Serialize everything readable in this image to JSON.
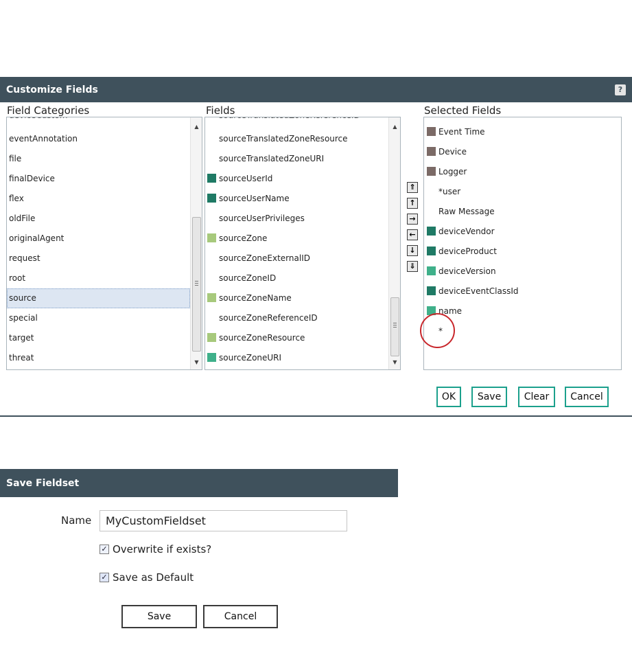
{
  "customize": {
    "title": "Customize Fields",
    "help_icon": "?",
    "categories_header": "Field Categories",
    "fields_header": "Fields",
    "selected_header": "Selected Fields",
    "categories": [
      {
        "label": "eventAnnotation",
        "selected": false
      },
      {
        "label": "file",
        "selected": false
      },
      {
        "label": "finalDevice",
        "selected": false
      },
      {
        "label": "flex",
        "selected": false
      },
      {
        "label": "oldFile",
        "selected": false
      },
      {
        "label": "originalAgent",
        "selected": false
      },
      {
        "label": "request",
        "selected": false
      },
      {
        "label": "root",
        "selected": false
      },
      {
        "label": "source",
        "selected": true
      },
      {
        "label": "special",
        "selected": false
      },
      {
        "label": "target",
        "selected": false
      },
      {
        "label": "threat",
        "selected": false
      }
    ],
    "fields": [
      {
        "label": "sourceTranslatedZoneResource",
        "color": ""
      },
      {
        "label": "sourceTranslatedZoneURI",
        "color": ""
      },
      {
        "label": "sourceUserId",
        "color": "#1f7a65"
      },
      {
        "label": "sourceUserName",
        "color": "#1f7a65"
      },
      {
        "label": "sourceUserPrivileges",
        "color": ""
      },
      {
        "label": "sourceZone",
        "color": "#a7c97c"
      },
      {
        "label": "sourceZoneExternalID",
        "color": ""
      },
      {
        "label": "sourceZoneID",
        "color": ""
      },
      {
        "label": "sourceZoneName",
        "color": "#a7c97c"
      },
      {
        "label": "sourceZoneReferenceID",
        "color": ""
      },
      {
        "label": "sourceZoneResource",
        "color": "#a7c97c"
      },
      {
        "label": "sourceZoneURI",
        "color": "#3fb08a"
      }
    ],
    "selected_fields": [
      {
        "label": "Event Time",
        "color": "#7b6a66"
      },
      {
        "label": "Device",
        "color": "#7b6a66"
      },
      {
        "label": "Logger",
        "color": "#7b6a66"
      },
      {
        "label": "*user",
        "color": ""
      },
      {
        "label": "Raw Message",
        "color": ""
      },
      {
        "label": "deviceVendor",
        "color": "#1f7a65"
      },
      {
        "label": "deviceProduct",
        "color": "#1f7a65"
      },
      {
        "label": "deviceVersion",
        "color": "#3fb08a"
      },
      {
        "label": "deviceEventClassId",
        "color": "#1f7a65"
      },
      {
        "label": "name",
        "color": "#3fb08a"
      },
      {
        "label": "*",
        "color": ""
      }
    ],
    "move_buttons": [
      "⇑",
      "↑",
      "→",
      "←",
      "↓",
      "⇓"
    ],
    "ok_label": "OK",
    "save_label": "Save",
    "clear_label": "Clear",
    "cancel_label": "Cancel"
  },
  "save_fieldset": {
    "title": "Save Fieldset",
    "name_label": "Name",
    "name_value": "MyCustomFieldset",
    "overwrite_label": "Overwrite if exists?",
    "overwrite_checked": true,
    "default_label": "Save as Default",
    "default_checked": true,
    "save_label": "Save",
    "cancel_label": "Cancel"
  }
}
